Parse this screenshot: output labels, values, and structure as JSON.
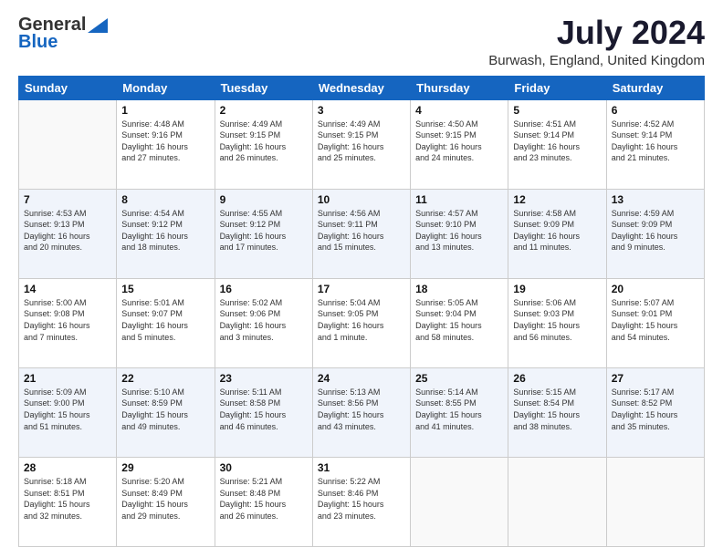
{
  "header": {
    "logo_line1": "General",
    "logo_line2": "Blue",
    "month_title": "July 2024",
    "location": "Burwash, England, United Kingdom"
  },
  "days_of_week": [
    "Sunday",
    "Monday",
    "Tuesday",
    "Wednesday",
    "Thursday",
    "Friday",
    "Saturday"
  ],
  "weeks": [
    [
      {
        "day": "",
        "info": ""
      },
      {
        "day": "1",
        "info": "Sunrise: 4:48 AM\nSunset: 9:16 PM\nDaylight: 16 hours\nand 27 minutes."
      },
      {
        "day": "2",
        "info": "Sunrise: 4:49 AM\nSunset: 9:15 PM\nDaylight: 16 hours\nand 26 minutes."
      },
      {
        "day": "3",
        "info": "Sunrise: 4:49 AM\nSunset: 9:15 PM\nDaylight: 16 hours\nand 25 minutes."
      },
      {
        "day": "4",
        "info": "Sunrise: 4:50 AM\nSunset: 9:15 PM\nDaylight: 16 hours\nand 24 minutes."
      },
      {
        "day": "5",
        "info": "Sunrise: 4:51 AM\nSunset: 9:14 PM\nDaylight: 16 hours\nand 23 minutes."
      },
      {
        "day": "6",
        "info": "Sunrise: 4:52 AM\nSunset: 9:14 PM\nDaylight: 16 hours\nand 21 minutes."
      }
    ],
    [
      {
        "day": "7",
        "info": "Sunrise: 4:53 AM\nSunset: 9:13 PM\nDaylight: 16 hours\nand 20 minutes."
      },
      {
        "day": "8",
        "info": "Sunrise: 4:54 AM\nSunset: 9:12 PM\nDaylight: 16 hours\nand 18 minutes."
      },
      {
        "day": "9",
        "info": "Sunrise: 4:55 AM\nSunset: 9:12 PM\nDaylight: 16 hours\nand 17 minutes."
      },
      {
        "day": "10",
        "info": "Sunrise: 4:56 AM\nSunset: 9:11 PM\nDaylight: 16 hours\nand 15 minutes."
      },
      {
        "day": "11",
        "info": "Sunrise: 4:57 AM\nSunset: 9:10 PM\nDaylight: 16 hours\nand 13 minutes."
      },
      {
        "day": "12",
        "info": "Sunrise: 4:58 AM\nSunset: 9:09 PM\nDaylight: 16 hours\nand 11 minutes."
      },
      {
        "day": "13",
        "info": "Sunrise: 4:59 AM\nSunset: 9:09 PM\nDaylight: 16 hours\nand 9 minutes."
      }
    ],
    [
      {
        "day": "14",
        "info": "Sunrise: 5:00 AM\nSunset: 9:08 PM\nDaylight: 16 hours\nand 7 minutes."
      },
      {
        "day": "15",
        "info": "Sunrise: 5:01 AM\nSunset: 9:07 PM\nDaylight: 16 hours\nand 5 minutes."
      },
      {
        "day": "16",
        "info": "Sunrise: 5:02 AM\nSunset: 9:06 PM\nDaylight: 16 hours\nand 3 minutes."
      },
      {
        "day": "17",
        "info": "Sunrise: 5:04 AM\nSunset: 9:05 PM\nDaylight: 16 hours\nand 1 minute."
      },
      {
        "day": "18",
        "info": "Sunrise: 5:05 AM\nSunset: 9:04 PM\nDaylight: 15 hours\nand 58 minutes."
      },
      {
        "day": "19",
        "info": "Sunrise: 5:06 AM\nSunset: 9:03 PM\nDaylight: 15 hours\nand 56 minutes."
      },
      {
        "day": "20",
        "info": "Sunrise: 5:07 AM\nSunset: 9:01 PM\nDaylight: 15 hours\nand 54 minutes."
      }
    ],
    [
      {
        "day": "21",
        "info": "Sunrise: 5:09 AM\nSunset: 9:00 PM\nDaylight: 15 hours\nand 51 minutes."
      },
      {
        "day": "22",
        "info": "Sunrise: 5:10 AM\nSunset: 8:59 PM\nDaylight: 15 hours\nand 49 minutes."
      },
      {
        "day": "23",
        "info": "Sunrise: 5:11 AM\nSunset: 8:58 PM\nDaylight: 15 hours\nand 46 minutes."
      },
      {
        "day": "24",
        "info": "Sunrise: 5:13 AM\nSunset: 8:56 PM\nDaylight: 15 hours\nand 43 minutes."
      },
      {
        "day": "25",
        "info": "Sunrise: 5:14 AM\nSunset: 8:55 PM\nDaylight: 15 hours\nand 41 minutes."
      },
      {
        "day": "26",
        "info": "Sunrise: 5:15 AM\nSunset: 8:54 PM\nDaylight: 15 hours\nand 38 minutes."
      },
      {
        "day": "27",
        "info": "Sunrise: 5:17 AM\nSunset: 8:52 PM\nDaylight: 15 hours\nand 35 minutes."
      }
    ],
    [
      {
        "day": "28",
        "info": "Sunrise: 5:18 AM\nSunset: 8:51 PM\nDaylight: 15 hours\nand 32 minutes."
      },
      {
        "day": "29",
        "info": "Sunrise: 5:20 AM\nSunset: 8:49 PM\nDaylight: 15 hours\nand 29 minutes."
      },
      {
        "day": "30",
        "info": "Sunrise: 5:21 AM\nSunset: 8:48 PM\nDaylight: 15 hours\nand 26 minutes."
      },
      {
        "day": "31",
        "info": "Sunrise: 5:22 AM\nSunset: 8:46 PM\nDaylight: 15 hours\nand 23 minutes."
      },
      {
        "day": "",
        "info": ""
      },
      {
        "day": "",
        "info": ""
      },
      {
        "day": "",
        "info": ""
      }
    ]
  ]
}
